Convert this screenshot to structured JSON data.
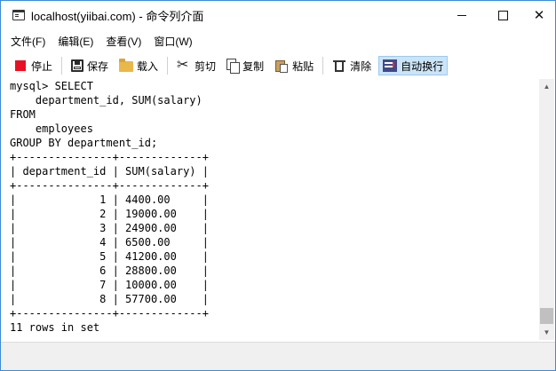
{
  "window": {
    "title": "localhost(yiibai.com) - 命令列介面"
  },
  "menu": {
    "items": [
      {
        "label": "文件(F)"
      },
      {
        "label": "编辑(E)"
      },
      {
        "label": "查看(V)"
      },
      {
        "label": "窗口(W)"
      }
    ]
  },
  "toolbar": {
    "stop": "停止",
    "save": "保存",
    "load": "载入",
    "cut": "剪切",
    "copy": "复制",
    "paste": "粘贴",
    "clear": "清除",
    "autowrap": "自动换行"
  },
  "console": {
    "lines": [
      "mysql> SELECT",
      "    department_id, SUM(salary)",
      "FROM",
      "    employees",
      "GROUP BY department_id;",
      "+---------------+-------------+",
      "| department_id | SUM(salary) |",
      "+---------------+-------------+",
      "|             1 | 4400.00     |",
      "|             2 | 19000.00    |",
      "|             3 | 24900.00    |",
      "|             4 | 6500.00     |",
      "|             5 | 41200.00    |",
      "|             6 | 28800.00    |",
      "|             7 | 10000.00    |",
      "|             8 | 57700.00    |",
      "+---------------+-------------+",
      "11 rows in set"
    ]
  },
  "colors": {
    "window_border": "#3c8bd5",
    "stop_icon": "#e81123",
    "active_button_bg": "#cce4f7"
  }
}
